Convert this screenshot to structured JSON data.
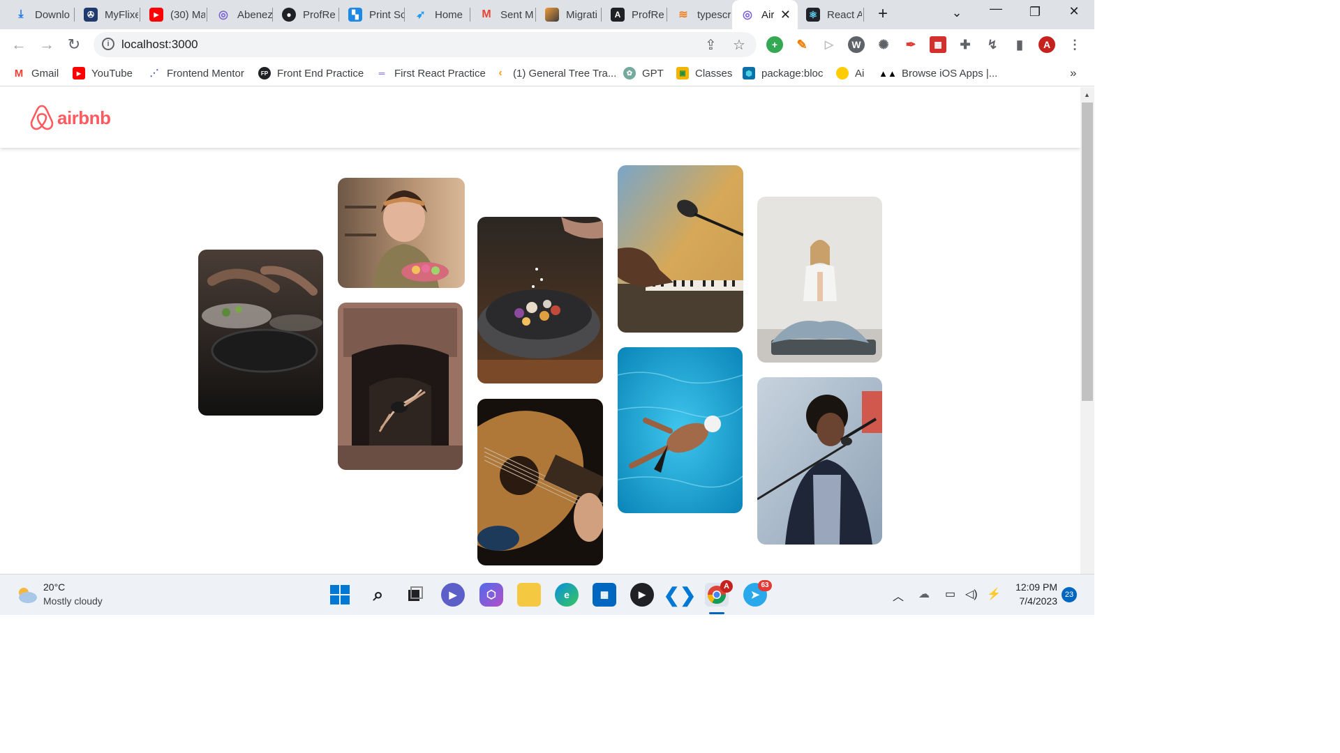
{
  "browser": {
    "tabs": [
      {
        "label": "Downlo",
        "icon": "download-icon"
      },
      {
        "label": "MyFlixe",
        "icon": "film-reel-icon"
      },
      {
        "label": "(30) Ma",
        "icon": "youtube-icon"
      },
      {
        "label": "Abenez",
        "icon": "airbnb-icon"
      },
      {
        "label": "ProfRe",
        "icon": "github-icon"
      },
      {
        "label": "Print Sc",
        "icon": "print-icon"
      },
      {
        "label": "Home",
        "icon": "twitter-icon"
      },
      {
        "label": "Sent M",
        "icon": "gmail-icon"
      },
      {
        "label": "Migrati",
        "icon": "migrate-icon"
      },
      {
        "label": "ProfRe",
        "icon": "angular-icon"
      },
      {
        "label": "typescr",
        "icon": "stackoverflow-icon"
      },
      {
        "label": "Air",
        "icon": "airbnb-icon",
        "active": true
      },
      {
        "label": "React A",
        "icon": "react-icon"
      }
    ],
    "new_tab": "+",
    "url": "localhost:3000",
    "profile_initial": "A",
    "bookmarks": [
      {
        "label": "Gmail",
        "icon": "gmail-icon"
      },
      {
        "label": "YouTube",
        "icon": "youtube-icon"
      },
      {
        "label": "Frontend Mentor",
        "icon": "frontend-mentor-icon"
      },
      {
        "label": "Front End Practice",
        "icon": "fp-icon"
      },
      {
        "label": "First React Practice",
        "icon": "react-practice-icon"
      },
      {
        "label": "(1) General Tree Tra...",
        "icon": "leetcode-icon"
      },
      {
        "label": "GPT",
        "icon": "openai-icon"
      },
      {
        "label": "Classes",
        "icon": "classroom-icon"
      },
      {
        "label": "package:bloc",
        "icon": "dart-icon"
      },
      {
        "label": "Ai",
        "icon": "pacman-icon"
      },
      {
        "label": "Browse iOS Apps |...",
        "icon": "mobbin-icon"
      }
    ],
    "more_bookmarks": "»"
  },
  "page": {
    "logo_text": "airbnb",
    "photos": [
      {
        "name": "photo-cooking",
        "subject": "hands cooking at a stove with pans",
        "colors": [
          "#3b3330",
          "#1d1a19"
        ]
      },
      {
        "name": "photo-woman-macarons",
        "subject": "woman holding a tray of macarons in a kitchen",
        "colors": [
          "#b08868",
          "#6e5746"
        ]
      },
      {
        "name": "photo-dancer",
        "subject": "dancer leaping in an ornate stone doorway",
        "colors": [
          "#8f6a5e",
          "#2b2220"
        ]
      },
      {
        "name": "photo-food-bowl",
        "subject": "seasoning a stone bowl of colorful food",
        "colors": [
          "#5c4b42",
          "#2a2320"
        ]
      },
      {
        "name": "photo-guitar",
        "subject": "hands playing an acoustic guitar",
        "colors": [
          "#8a5a2c",
          "#1a1310"
        ]
      },
      {
        "name": "photo-piano-mic",
        "subject": "hands on a keyboard with a microphone",
        "colors": [
          "#c79a55",
          "#3b3226"
        ]
      },
      {
        "name": "photo-swimmer",
        "subject": "swimmer in a bright blue pool",
        "colors": [
          "#2fb4e0",
          "#0b6e98"
        ]
      },
      {
        "name": "photo-yoga",
        "subject": "woman meditating in a yoga pose",
        "colors": [
          "#e8e4de",
          "#9aa4ab"
        ]
      },
      {
        "name": "photo-singer",
        "subject": "singer performing into a microphone",
        "colors": [
          "#c9d2dc",
          "#2a3548"
        ]
      }
    ]
  },
  "taskbar": {
    "weather_temp": "20°C",
    "weather_desc": "Mostly cloudy",
    "time": "12:09 PM",
    "date": "7/4/2023",
    "notification_count": "23",
    "chrome_badge": "A",
    "telegram_badge": "63"
  }
}
